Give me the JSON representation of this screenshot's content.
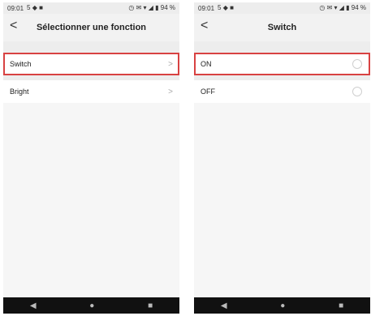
{
  "left": {
    "status": {
      "time": "09:01",
      "icons_left": "5 ◆ ■",
      "icons_right": "◷ ✉ ▾ ◢ ▮ 94 %"
    },
    "header": {
      "back_glyph": "<",
      "title": "Sélectionner une fonction"
    },
    "items": [
      {
        "label": "Switch",
        "indicator": ">"
      },
      {
        "label": "Bright",
        "indicator": ">"
      }
    ],
    "nav": {
      "back": "◀",
      "home": "●",
      "recent": "■"
    }
  },
  "right": {
    "status": {
      "time": "09:01",
      "icons_left": "5 ◆ ■",
      "icons_right": "◷ ✉ ▾ ◢ ▮ 94 %"
    },
    "header": {
      "back_glyph": "<",
      "title": "Switch"
    },
    "options": [
      {
        "label": "ON"
      },
      {
        "label": "OFF"
      }
    ],
    "nav": {
      "back": "◀",
      "home": "●",
      "recent": "■"
    }
  },
  "colors": {
    "highlight": "#d84242",
    "background": "#ededed"
  }
}
